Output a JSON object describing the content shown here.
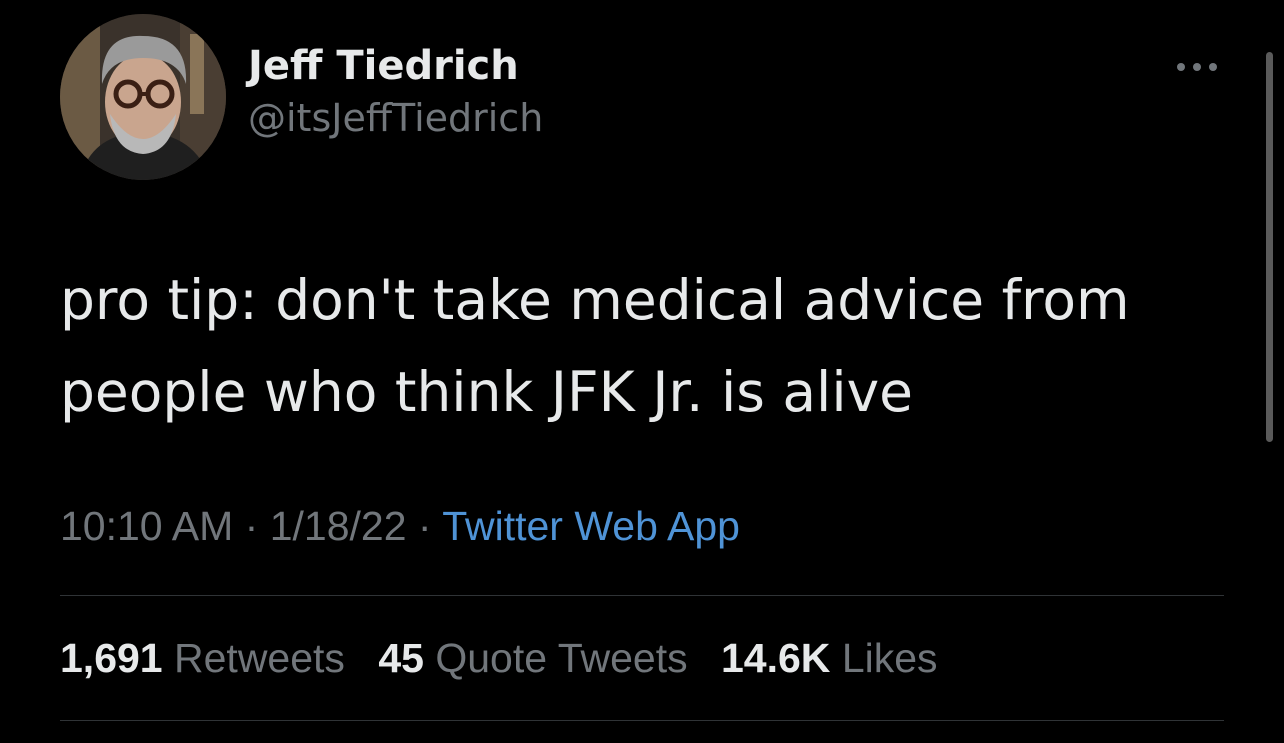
{
  "tweet": {
    "author": {
      "display_name": "Jeff Tiedrich",
      "handle": "@itsJeffTiedrich",
      "avatar_icon": "profile-photo"
    },
    "text": "pro tip: don't take medical advice from\npeople who think JFK Jr. is alive",
    "meta": {
      "time": "10:10 AM",
      "separator": "·",
      "date": "1/18/22",
      "source": "Twitter Web App"
    },
    "stats": {
      "retweets_count": "1,691",
      "retweets_label": "Retweets",
      "quote_tweets_count": "45",
      "quote_tweets_label": "Quote Tweets",
      "likes_count": "14.6K",
      "likes_label": "Likes"
    },
    "more_icon": "more-horizontal-icon"
  },
  "colors": {
    "background": "#000000",
    "primary_text": "#e7e9ea",
    "secondary_text": "#71767b",
    "link": "#4f93d6",
    "divider": "#2f3336"
  }
}
